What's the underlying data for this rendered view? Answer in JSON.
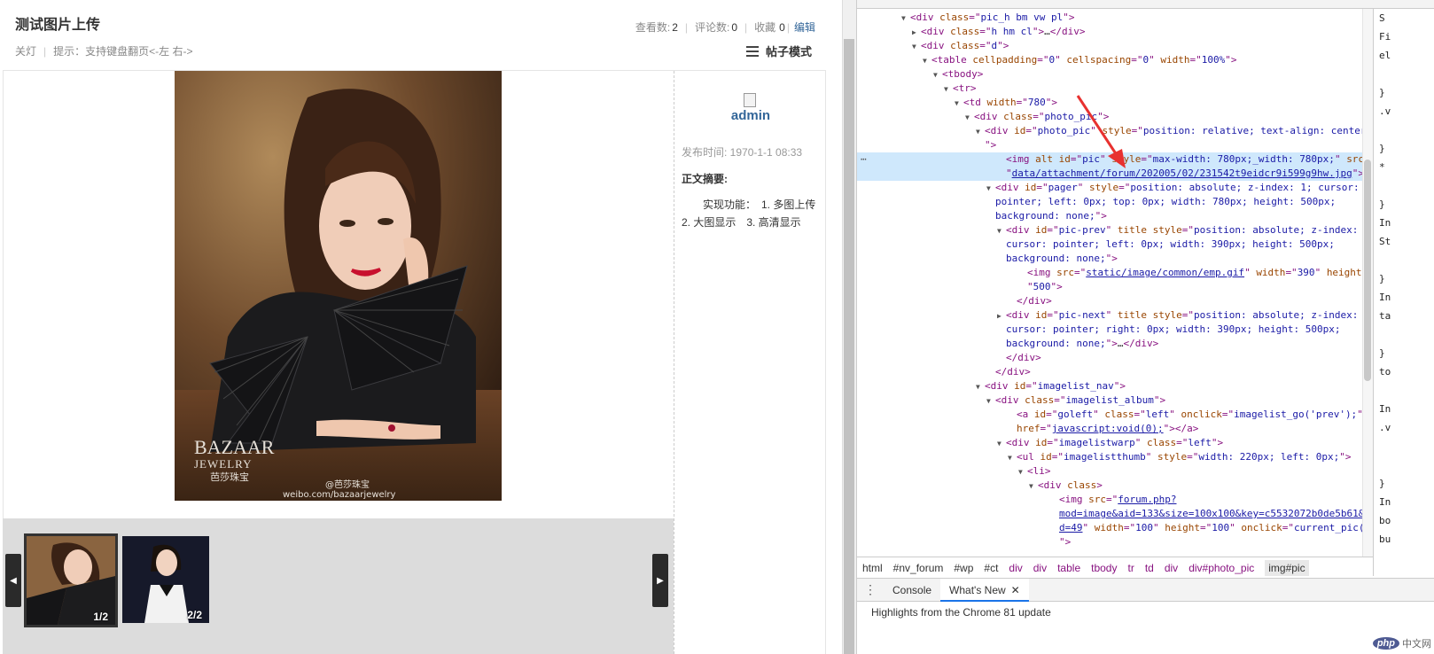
{
  "header": {
    "title": "测试图片上传",
    "close_label": "关灯",
    "hint": "提示：支持键盘翻页<-左 右->",
    "views_label": "查看数:",
    "views": "2",
    "comments_label": "评论数:",
    "comments": "0",
    "favorites_label": "收藏",
    "favorites": "0",
    "edit_label": "编辑",
    "mode_label": "帖子模式"
  },
  "photo": {
    "watermark_brand": "BAZAAR",
    "watermark_sub": "JEWELRY",
    "watermark_cn": "芭莎珠宝",
    "weibo_handle": "@芭莎珠宝",
    "weibo_url": "weibo.com/bazaarjewelry"
  },
  "sidebar": {
    "author": "admin",
    "publish_time": "发布时间: 1970-1-1 08:33",
    "summary_label": "正文摘要:",
    "summary_text": "实现功能：　1. 多图上传　2. 大图显示　3. 高清显示"
  },
  "thumbnails": [
    {
      "counter": "1/2",
      "active": true
    },
    {
      "counter": "2/2",
      "active": false
    }
  ],
  "devtools": {
    "dom_lines": [
      {
        "indent": 4,
        "tri": "▼",
        "html": [
          [
            "tg",
            "<div "
          ],
          [
            "an",
            "class"
          ],
          [
            "tg",
            "=\""
          ],
          [
            "av",
            "pic_h bm vw pl"
          ],
          [
            "tg",
            "\">"
          ]
        ]
      },
      {
        "indent": 5,
        "tri": "▶",
        "html": [
          [
            "tg",
            "<div "
          ],
          [
            "an",
            "class"
          ],
          [
            "tg",
            "=\""
          ],
          [
            "av",
            "h hm cl"
          ],
          [
            "tg",
            "\">"
          ],
          [
            "p",
            "…"
          ],
          [
            "tg",
            "</div>"
          ]
        ]
      },
      {
        "indent": 5,
        "tri": "▼",
        "html": [
          [
            "tg",
            "<div "
          ],
          [
            "an",
            "class"
          ],
          [
            "tg",
            "=\""
          ],
          [
            "av",
            "d"
          ],
          [
            "tg",
            "\">"
          ]
        ]
      },
      {
        "indent": 6,
        "tri": "▼",
        "html": [
          [
            "tg",
            "<table "
          ],
          [
            "an",
            "cellpadding"
          ],
          [
            "tg",
            "=\""
          ],
          [
            "av",
            "0"
          ],
          [
            "tg",
            "\" "
          ],
          [
            "an",
            "cellspacing"
          ],
          [
            "tg",
            "=\""
          ],
          [
            "av",
            "0"
          ],
          [
            "tg",
            "\" "
          ],
          [
            "an",
            "width"
          ],
          [
            "tg",
            "=\""
          ],
          [
            "av",
            "100%"
          ],
          [
            "tg",
            "\">"
          ]
        ]
      },
      {
        "indent": 7,
        "tri": "▼",
        "html": [
          [
            "tg",
            "<tbody>"
          ]
        ]
      },
      {
        "indent": 8,
        "tri": "▼",
        "html": [
          [
            "tg",
            "<tr>"
          ]
        ]
      },
      {
        "indent": 9,
        "tri": "▼",
        "html": [
          [
            "tg",
            "<td "
          ],
          [
            "an",
            "width"
          ],
          [
            "tg",
            "=\""
          ],
          [
            "av",
            "780"
          ],
          [
            "tg",
            "\">"
          ]
        ]
      },
      {
        "indent": 10,
        "tri": "▼",
        "html": [
          [
            "tg",
            "<div "
          ],
          [
            "an",
            "class"
          ],
          [
            "tg",
            "=\""
          ],
          [
            "av",
            "photo_pic"
          ],
          [
            "tg",
            "\">"
          ]
        ]
      },
      {
        "indent": 11,
        "tri": "▼",
        "html": [
          [
            "tg",
            "<div "
          ],
          [
            "an",
            "id"
          ],
          [
            "tg",
            "=\""
          ],
          [
            "av",
            "photo_pic"
          ],
          [
            "tg",
            "\" "
          ],
          [
            "an",
            "style"
          ],
          [
            "tg",
            "=\""
          ],
          [
            "av",
            "position: relative; text-align: center;"
          ]
        ]
      },
      {
        "indent": 11,
        "tri": "",
        "html": [
          [
            "tg",
            "\">"
          ]
        ]
      },
      {
        "indent": 13,
        "tri": "",
        "sel": true,
        "html": [
          [
            "tg",
            "<img "
          ],
          [
            "an",
            "alt id"
          ],
          [
            "tg",
            "=\""
          ],
          [
            "av",
            "pic"
          ],
          [
            "tg",
            "\" "
          ],
          [
            "an",
            "style"
          ],
          [
            "tg",
            "=\""
          ],
          [
            "av",
            "max-width: 780px;_width: 780px;"
          ],
          [
            "tg",
            "\" "
          ],
          [
            "an",
            "src"
          ],
          [
            "tg",
            "="
          ]
        ]
      },
      {
        "indent": 13,
        "tri": "",
        "sel": true,
        "html": [
          [
            "tg",
            "\""
          ],
          [
            "lk",
            "data/attachment/forum/202005/02/231542t9eidcr9i599g9hw.jpg"
          ],
          [
            "tg",
            "\">"
          ],
          [
            "p",
            " =="
          ]
        ]
      },
      {
        "indent": 12,
        "tri": "▼",
        "html": [
          [
            "tg",
            "<div "
          ],
          [
            "an",
            "id"
          ],
          [
            "tg",
            "=\""
          ],
          [
            "av",
            "pager"
          ],
          [
            "tg",
            "\" "
          ],
          [
            "an",
            "style"
          ],
          [
            "tg",
            "=\""
          ],
          [
            "av",
            "position: absolute; z-index: 1; cursor:"
          ]
        ]
      },
      {
        "indent": 12,
        "tri": "",
        "html": [
          [
            "av",
            "pointer; left: 0px; top: 0px; width: 780px; height: 500px;"
          ]
        ]
      },
      {
        "indent": 12,
        "tri": "",
        "html": [
          [
            "av",
            "background: none;"
          ],
          [
            "tg",
            "\">"
          ]
        ]
      },
      {
        "indent": 13,
        "tri": "▼",
        "html": [
          [
            "tg",
            "<div "
          ],
          [
            "an",
            "id"
          ],
          [
            "tg",
            "=\""
          ],
          [
            "av",
            "pic-prev"
          ],
          [
            "tg",
            "\" "
          ],
          [
            "an",
            "title style"
          ],
          [
            "tg",
            "=\""
          ],
          [
            "av",
            "position: absolute; z-index: 1;"
          ]
        ]
      },
      {
        "indent": 13,
        "tri": "",
        "html": [
          [
            "av",
            "cursor: pointer; left: 0px; width: 390px; height: 500px;"
          ]
        ]
      },
      {
        "indent": 13,
        "tri": "",
        "html": [
          [
            "av",
            "background: none;"
          ],
          [
            "tg",
            "\">"
          ]
        ]
      },
      {
        "indent": 15,
        "tri": "",
        "html": [
          [
            "tg",
            "<img "
          ],
          [
            "an",
            "src"
          ],
          [
            "tg",
            "=\""
          ],
          [
            "lk",
            "static/image/common/emp.gif"
          ],
          [
            "tg",
            "\" "
          ],
          [
            "an",
            "width"
          ],
          [
            "tg",
            "=\""
          ],
          [
            "av",
            "390"
          ],
          [
            "tg",
            "\" "
          ],
          [
            "an",
            "height"
          ],
          [
            "tg",
            "="
          ]
        ]
      },
      {
        "indent": 15,
        "tri": "",
        "html": [
          [
            "tg",
            "\""
          ],
          [
            "av",
            "500"
          ],
          [
            "tg",
            "\">"
          ]
        ]
      },
      {
        "indent": 14,
        "tri": "",
        "html": [
          [
            "tg",
            "</div>"
          ]
        ]
      },
      {
        "indent": 13,
        "tri": "▶",
        "html": [
          [
            "tg",
            "<div "
          ],
          [
            "an",
            "id"
          ],
          [
            "tg",
            "=\""
          ],
          [
            "av",
            "pic-next"
          ],
          [
            "tg",
            "\" "
          ],
          [
            "an",
            "title style"
          ],
          [
            "tg",
            "=\""
          ],
          [
            "av",
            "position: absolute; z-index: 1;"
          ]
        ]
      },
      {
        "indent": 13,
        "tri": "",
        "html": [
          [
            "av",
            "cursor: pointer; right: 0px; width: 390px; height: 500px;"
          ]
        ]
      },
      {
        "indent": 13,
        "tri": "",
        "html": [
          [
            "av",
            "background: none;"
          ],
          [
            "tg",
            "\">"
          ],
          [
            "p",
            "…"
          ],
          [
            "tg",
            "</div>"
          ]
        ]
      },
      {
        "indent": 13,
        "tri": "",
        "html": [
          [
            "tg",
            "</div>"
          ]
        ]
      },
      {
        "indent": 12,
        "tri": "",
        "html": [
          [
            "tg",
            "</div>"
          ]
        ]
      },
      {
        "indent": 11,
        "tri": "▼",
        "html": [
          [
            "tg",
            "<div "
          ],
          [
            "an",
            "id"
          ],
          [
            "tg",
            "=\""
          ],
          [
            "av",
            "imagelist_nav"
          ],
          [
            "tg",
            "\">"
          ]
        ]
      },
      {
        "indent": 12,
        "tri": "▼",
        "html": [
          [
            "tg",
            "<div "
          ],
          [
            "an",
            "class"
          ],
          [
            "tg",
            "=\""
          ],
          [
            "av",
            "imagelist_album"
          ],
          [
            "tg",
            "\">"
          ]
        ]
      },
      {
        "indent": 14,
        "tri": "",
        "html": [
          [
            "tg",
            "<a "
          ],
          [
            "an",
            "id"
          ],
          [
            "tg",
            "=\""
          ],
          [
            "av",
            "goleft"
          ],
          [
            "tg",
            "\" "
          ],
          [
            "an",
            "class"
          ],
          [
            "tg",
            "=\""
          ],
          [
            "av",
            "left"
          ],
          [
            "tg",
            "\" "
          ],
          [
            "an",
            "onclick"
          ],
          [
            "tg",
            "=\""
          ],
          [
            "av",
            "imagelist_go('prev');"
          ],
          [
            "tg",
            "\""
          ]
        ]
      },
      {
        "indent": 14,
        "tri": "",
        "html": [
          [
            "an",
            "href"
          ],
          [
            "tg",
            "=\""
          ],
          [
            "lk",
            "javascript:void(0);"
          ],
          [
            "tg",
            "\"></a>"
          ]
        ]
      },
      {
        "indent": 13,
        "tri": "▼",
        "html": [
          [
            "tg",
            "<div "
          ],
          [
            "an",
            "id"
          ],
          [
            "tg",
            "=\""
          ],
          [
            "av",
            "imagelistwarp"
          ],
          [
            "tg",
            "\" "
          ],
          [
            "an",
            "class"
          ],
          [
            "tg",
            "=\""
          ],
          [
            "av",
            "left"
          ],
          [
            "tg",
            "\">"
          ]
        ]
      },
      {
        "indent": 14,
        "tri": "▼",
        "html": [
          [
            "tg",
            "<ul "
          ],
          [
            "an",
            "id"
          ],
          [
            "tg",
            "=\""
          ],
          [
            "av",
            "imagelistthumb"
          ],
          [
            "tg",
            "\" "
          ],
          [
            "an",
            "style"
          ],
          [
            "tg",
            "=\""
          ],
          [
            "av",
            "width: 220px; left: 0px;"
          ],
          [
            "tg",
            "\">"
          ]
        ]
      },
      {
        "indent": 15,
        "tri": "▼",
        "html": [
          [
            "tg",
            "<li>"
          ]
        ]
      },
      {
        "indent": 16,
        "tri": "▼",
        "html": [
          [
            "tg",
            "<div "
          ],
          [
            "an",
            "class"
          ],
          [
            "tg",
            ">"
          ]
        ]
      },
      {
        "indent": 18,
        "tri": "",
        "html": [
          [
            "tg",
            "<img "
          ],
          [
            "an",
            "src"
          ],
          [
            "tg",
            "=\""
          ],
          [
            "lk",
            "forum.php?"
          ]
        ]
      },
      {
        "indent": 18,
        "tri": "",
        "html": [
          [
            "lk",
            "mod=image&aid=133&size=100x100&key=c5532072b0de5b61&ati"
          ]
        ]
      },
      {
        "indent": 18,
        "tri": "",
        "html": [
          [
            "lk",
            "d=49"
          ],
          [
            "tg",
            "\" "
          ],
          [
            "an",
            "width"
          ],
          [
            "tg",
            "=\""
          ],
          [
            "av",
            "100"
          ],
          [
            "tg",
            "\" "
          ],
          [
            "an",
            "height"
          ],
          [
            "tg",
            "=\""
          ],
          [
            "av",
            "100"
          ],
          [
            "tg",
            "\" "
          ],
          [
            "an",
            "onclick"
          ],
          [
            "tg",
            "=\""
          ],
          [
            "av",
            "current_pic(0);"
          ]
        ]
      },
      {
        "indent": 18,
        "tri": "",
        "html": [
          [
            "tg",
            "\">"
          ]
        ]
      }
    ],
    "styles_snippets": [
      "S",
      "Fi",
      "el",
      "",
      "}",
      ".v",
      "",
      "}",
      "*",
      "",
      "}",
      "In",
      "St",
      "",
      "}",
      "In",
      "ta",
      "",
      "}",
      "to",
      "",
      "In",
      ".v",
      "",
      "",
      "}",
      "In",
      "bo",
      "bu"
    ],
    "breadcrumb": [
      "html",
      "#nv_forum",
      "#wp",
      "#ct",
      "div",
      "div",
      "table",
      "tbody",
      "tr",
      "td",
      "div",
      "div#photo_pic",
      "img#pic"
    ],
    "drawer_tabs": [
      "Console",
      "What's New"
    ],
    "drawer_message": "Highlights from the Chrome 81 update",
    "logo_text": "php",
    "logo_cn": "中文网"
  },
  "colors": {
    "accent_link": "#336699",
    "selection": "#cfe8fc",
    "arrow": "#e8312f"
  }
}
